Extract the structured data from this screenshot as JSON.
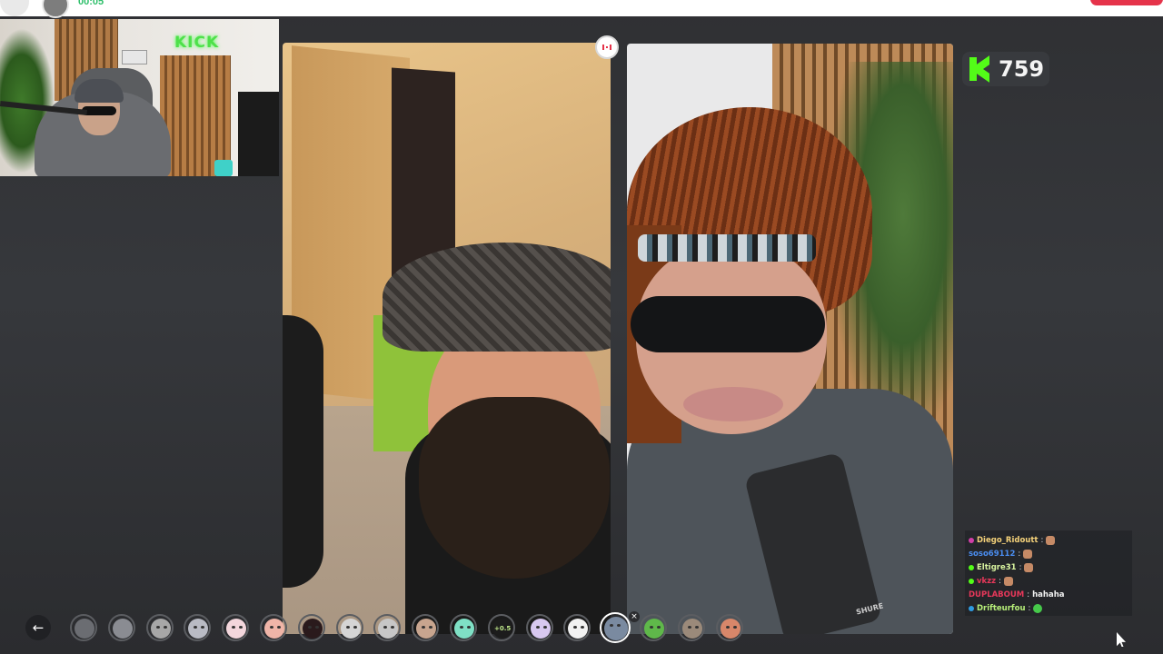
{
  "header": {
    "timer": "00:05"
  },
  "webcam": {
    "sign_text": "KICK"
  },
  "viewer_badge": {
    "count": "759",
    "icon": "kick-logo-icon",
    "accent": "#53fc18"
  },
  "call": {
    "stop_icon": "end-call-icon",
    "left_video": "remote-participant-video",
    "right_video": "streamer-video-with-face-filter",
    "mic_brand": "SHURE"
  },
  "chat": {
    "messages": [
      {
        "user": "Diego_Ridoutt",
        "sep": ":",
        "message": "",
        "user_color": "#f5d27a",
        "badge_color": "#d13fa8",
        "emote": "reaction-emote"
      },
      {
        "user": "soso69112",
        "sep": ":",
        "message": "",
        "user_color": "#4a8df0",
        "badge_color": "",
        "emote": "reaction-emote"
      },
      {
        "user": "Eltigre31",
        "sep": ":",
        "message": "",
        "user_color": "#d9f5a0",
        "badge_color": "#53fc18",
        "emote": "reaction-emote"
      },
      {
        "user": "vkzz",
        "sep": ":",
        "message": "",
        "user_color": "#e8385a",
        "badge_color": "#53fc18",
        "emote": "reaction-emote"
      },
      {
        "user": "DUPLABOUM",
        "sep": ":",
        "message": "hahaha",
        "user_color": "#e8385a",
        "badge_color": "",
        "emote": ""
      },
      {
        "user": "Drifteurfou",
        "sep": ":",
        "message": "",
        "user_color": "#b8f07a",
        "badge_color": "#2f9be0",
        "emote": "green-emote"
      }
    ]
  },
  "filter_bar": {
    "back_icon": "arrow-left-icon",
    "back_glyph": "←",
    "close_glyph": "×",
    "speed_label": "+0.5",
    "filters": [
      {
        "name": "filter-dots",
        "color": "#6b6d72"
      },
      {
        "name": "filter-blur",
        "color": "#8a8c92"
      },
      {
        "name": "filter-gray-face",
        "color": "#a7a7a7"
      },
      {
        "name": "filter-sad-face",
        "color": "#b9bbc4"
      },
      {
        "name": "filter-cat-face",
        "color": "#f3d6dc"
      },
      {
        "name": "filter-blush-face",
        "color": "#f0b5a8"
      },
      {
        "name": "filter-demon-face",
        "color": "#2a1a1c"
      },
      {
        "name": "filter-frown-face",
        "color": "#d5d5d5"
      },
      {
        "name": "filter-shades-face",
        "color": "#c7c7c7"
      },
      {
        "name": "filter-beard-face",
        "color": "#c8a58f"
      },
      {
        "name": "filter-zombie-face",
        "color": "#7fe0c5"
      },
      {
        "name": "filter-speed",
        "color": "#1c1c1c"
      },
      {
        "name": "filter-baby-face",
        "color": "#d8c8f0"
      },
      {
        "name": "filter-panda-face",
        "color": "#f2f2f2"
      },
      {
        "name": "filter-hair-face",
        "color": "#7a8aa0",
        "selected": true
      },
      {
        "name": "filter-alien-face",
        "color": "#5fb84a"
      },
      {
        "name": "filter-goat-face",
        "color": "#9b8a7a"
      },
      {
        "name": "filter-bald-face",
        "color": "#d8876a"
      }
    ]
  }
}
